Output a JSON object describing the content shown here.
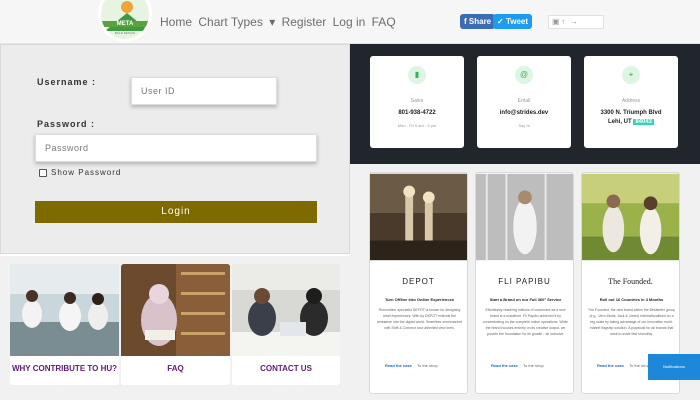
{
  "header": {
    "logo_text": "META",
    "logo_tagline": "BOLD DESIGN",
    "nav": [
      {
        "label": "Home"
      },
      {
        "label": "Chart Types"
      },
      {
        "label": "▾"
      },
      {
        "label": "Register"
      },
      {
        "label": "Log in"
      },
      {
        "label": "FAQ"
      }
    ],
    "share_label": "Share",
    "tweet_label": "Tweet"
  },
  "login": {
    "username_label": "Username :",
    "username_placeholder": "User ID",
    "password_label": "Password :",
    "password_placeholder": "Password",
    "show_password_label": "Show Password",
    "login_button": "Login",
    "button_color": "#7d6a00"
  },
  "promo_cards": [
    {
      "caption": "WHY CONTRIBUTE TO HU?"
    },
    {
      "caption": "FAQ"
    },
    {
      "caption": "CONTACT US"
    }
  ],
  "contact": [
    {
      "title": "Sales",
      "value": "801-938-4722",
      "note": "Mon - Fri 9 am - 5 pm",
      "icon": "phone-icon"
    },
    {
      "title": "Email",
      "value": "info@strides.dev",
      "note": "Say hi",
      "icon": "at-icon"
    },
    {
      "title": "Address",
      "value_line1": "3300 N. Triumph Blvd",
      "value_line2_prefix": "Lehi, UT",
      "zip": "84043",
      "icon": "map-pin-icon"
    }
  ],
  "articles": [
    {
      "brand": "DEPOT",
      "headline": "Turn Offline Into Online Experiences",
      "body": "Renovation specialist DEPOT is known for designing retail experiences. With Ay DEPOT extends the ambiance into the digital world. Seamless omnichannel with Shift & Connect and unlimited view lines.",
      "read_more": "Read the case",
      "shop": "To the shop"
    },
    {
      "brand": "FLI PAPIBU",
      "headline": "Start a Brand on our Full 360° Service",
      "body": "Effortlessly reaching millions of customers as a new brand is a marathon. Fli Papibu achieved it by concentrating on the complete online operations. While the brand focuses entirely on its creative output, we provide the foundation for its growth - all inclusive.",
      "read_more": "Read the case",
      "shop": "To the shop"
    },
    {
      "brand": "The Founded.",
      "headline": "Roll out 16 Countries in 3 Months",
      "body": "The Founded, the new brand within the Bestseller group (e.g., Vero Moda, Jack & Jones) internationalised on a big scale by taking advantage of our innovative multi-market flagship solution. A playbook for all brands that want to scale fast smoothly.",
      "read_more": "Read the case",
      "shop": "To the shop"
    }
  ],
  "toast_text": "Notifications"
}
